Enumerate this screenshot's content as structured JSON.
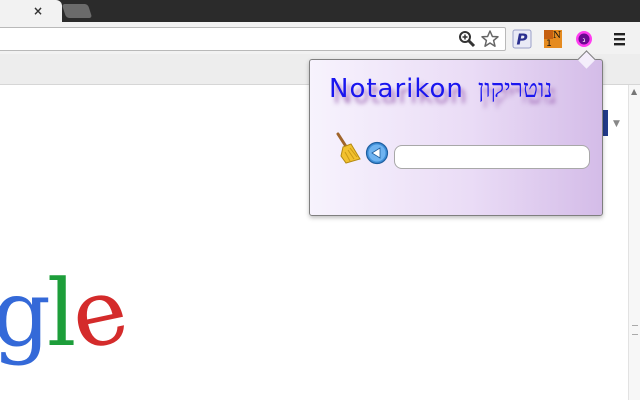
{
  "tabs": {
    "close_glyph": "×"
  },
  "popup": {
    "title_latin": "Notarikon",
    "title_hebrew": "נוטריקון",
    "title_color": "#1a16ef",
    "input_value": ""
  },
  "page": {
    "logo_letters": [
      "g",
      "l",
      "e"
    ],
    "logo_colors": [
      "#3469d8",
      "#1d9e3a",
      "#d42b2b"
    ]
  },
  "icons": {
    "zoom": "magnifier-plus-icon",
    "star": "bookmark-star-icon",
    "ext_p": "p-extension-icon",
    "ext_1n": "1n-extension-icon",
    "ext_notarikon": "notarikon-extension-icon",
    "menu": "hamburger-menu-icon",
    "broom": "broom-icon",
    "back": "back-arrow-icon"
  }
}
